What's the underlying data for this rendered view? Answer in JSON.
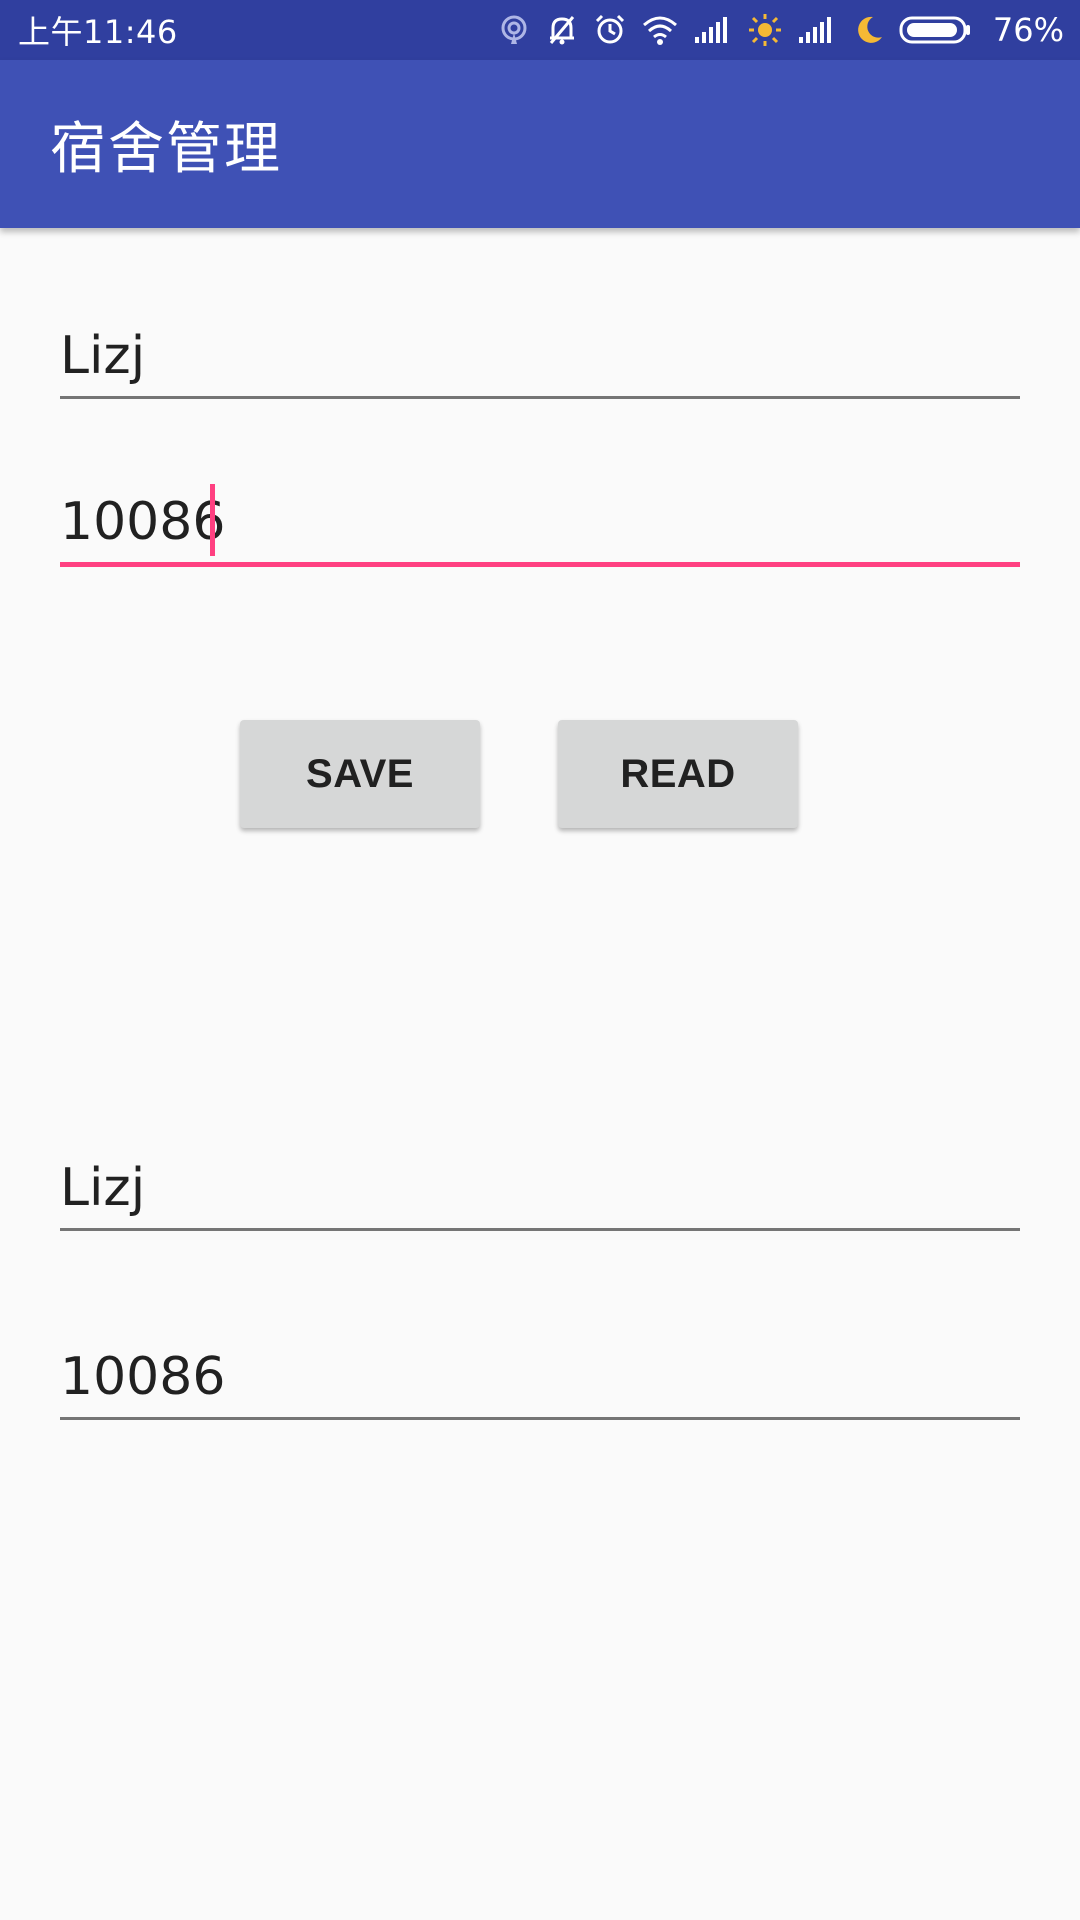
{
  "status_bar": {
    "time": "上午11:46",
    "battery_percent": "76%",
    "icons": [
      "hotspot-icon",
      "bell-off-icon",
      "alarm-icon",
      "wifi-icon",
      "signal-icon",
      "sun-icon",
      "signal-icon",
      "moon-icon",
      "battery-icon"
    ],
    "colors": {
      "background": "#303f9f",
      "sun": "#f5b935",
      "moon": "#f5b935"
    }
  },
  "app_bar": {
    "title": "宿舍管理",
    "color": "#3f51b5"
  },
  "form": {
    "name_value": "Lizj",
    "number_value": "10086",
    "accent_color": "#ff4081"
  },
  "buttons": {
    "save_label": "SAVE",
    "read_label": "READ"
  },
  "result": {
    "name_value": "Lizj",
    "number_value": "10086"
  }
}
